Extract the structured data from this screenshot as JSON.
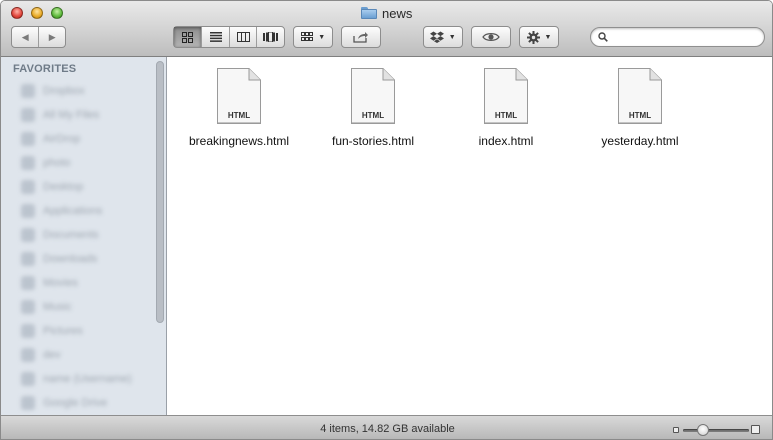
{
  "window": {
    "title": "news"
  },
  "toolbar": {
    "view_mode_active": "icon",
    "colors": {
      "accent_active": "#8e8e8e"
    }
  },
  "search": {
    "placeholder": "",
    "value": ""
  },
  "sidebar": {
    "heading": "FAVORITES",
    "items": [
      {
        "label": "Dropbox"
      },
      {
        "label": "All My Files"
      },
      {
        "label": "AirDrop"
      },
      {
        "label": "photo"
      },
      {
        "label": "Desktop"
      },
      {
        "label": "Applications"
      },
      {
        "label": "Documents"
      },
      {
        "label": "Downloads"
      },
      {
        "label": "Movies"
      },
      {
        "label": "Music"
      },
      {
        "label": "Pictures"
      },
      {
        "label": "dev"
      },
      {
        "label": "name (Username)"
      },
      {
        "label": "Google Drive"
      }
    ]
  },
  "files": [
    {
      "name": "breakingnews.html",
      "type_label": "HTML"
    },
    {
      "name": "fun-stories.html",
      "type_label": "HTML"
    },
    {
      "name": "index.html",
      "type_label": "HTML"
    },
    {
      "name": "yesterday.html",
      "type_label": "HTML"
    }
  ],
  "status": {
    "text": "4 items, 14.82 GB available"
  },
  "icon_size_slider": {
    "value": 0.3
  }
}
